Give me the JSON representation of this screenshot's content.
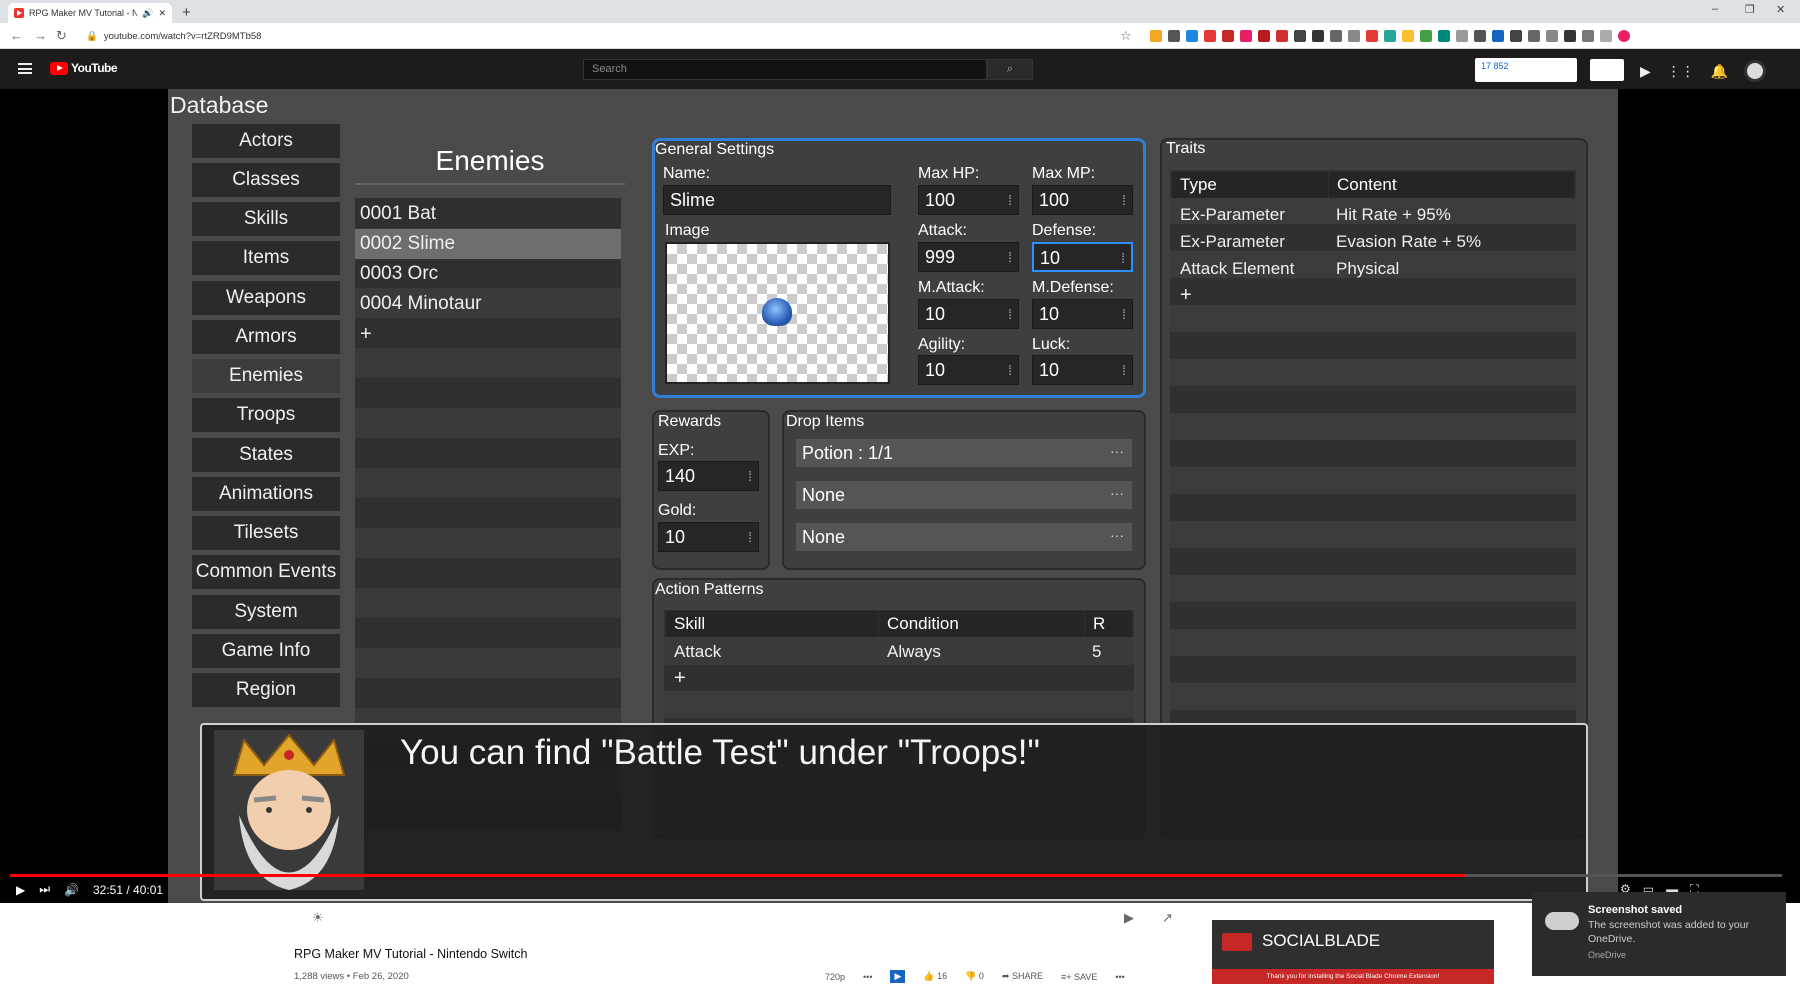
{
  "browser": {
    "tab_title": "RPG Maker MV Tutorial - Ni",
    "url": "youtube.com/watch?v=rtZRD9MTb58",
    "new_tab": "+",
    "win_min": "–",
    "win_max": "❐",
    "win_close": "✕",
    "back": "←",
    "forward": "→",
    "reload": "↻",
    "star": "☆"
  },
  "youtube": {
    "logo": "YouTube",
    "search_placeholder": "Search",
    "stats": "17 852",
    "video_title": "RPG Maker MV Tutorial - Nintendo Switch",
    "views_date": "1,288 views • Feb 26, 2020",
    "likes": "16",
    "dislikes": "0",
    "share": "SHARE",
    "save": "SAVE",
    "quality": "720p",
    "time": "32:51 / 40:01",
    "progress": 0.821
  },
  "game": {
    "db_title": "Database",
    "categories": [
      "Actors",
      "Classes",
      "Skills",
      "Items",
      "Weapons",
      "Armors",
      "Enemies",
      "Troops",
      "States",
      "Animations",
      "Tilesets",
      "Common Events",
      "System",
      "Game Info",
      "Region"
    ],
    "selected_category": "Enemies",
    "enemies_header": "Enemies",
    "enemies": [
      "0001 Bat",
      "0002 Slime",
      "0003 Orc",
      "0004 Minotaur"
    ],
    "selected_enemy": "0002 Slime",
    "add": "+",
    "general": {
      "title": "General Settings",
      "name_label": "Name:",
      "name_value": "Slime",
      "image_label": "Image",
      "max_hp_label": "Max HP:",
      "max_hp": "100",
      "max_mp_label": "Max MP:",
      "max_mp": "100",
      "attack_label": "Attack:",
      "attack": "999",
      "defense_label": "Defense:",
      "defense": "10",
      "matk_label": "M.Attack:",
      "matk": "10",
      "mdef_label": "M.Defense:",
      "mdef": "10",
      "agility_label": "Agility:",
      "agility": "10",
      "luck_label": "Luck:",
      "luck": "10"
    },
    "rewards": {
      "title": "Rewards",
      "exp_label": "EXP:",
      "exp": "140",
      "gold_label": "Gold:",
      "gold": "10"
    },
    "drops": {
      "title": "Drop Items",
      "items": [
        "Potion : 1/1",
        "None",
        "None"
      ],
      "dots": "···"
    },
    "actions": {
      "title": "Action Patterns",
      "headers": [
        "Skill",
        "Condition",
        "R"
      ],
      "rows": [
        {
          "skill": "Attack",
          "condition": "Always",
          "r": "5"
        }
      ]
    },
    "traits": {
      "title": "Traits",
      "headers": [
        "Type",
        "Content"
      ],
      "rows": [
        {
          "type": "Ex-Parameter",
          "content": "Hit Rate + 95%"
        },
        {
          "type": "Ex-Parameter",
          "content": "Evasion Rate + 5%"
        },
        {
          "type": "Attack Element",
          "content": "Physical"
        }
      ]
    },
    "dialogue": "You can find \"Battle Test\" under \"Troops!\""
  },
  "socialblade": {
    "title": "SOCIALBLADE",
    "sub": "Thank you for installing the Social Blade Chrome Extension!"
  },
  "toast": {
    "title": "Screenshot saved",
    "body": "The screenshot was added to your OneDrive.",
    "source": "OneDrive"
  }
}
